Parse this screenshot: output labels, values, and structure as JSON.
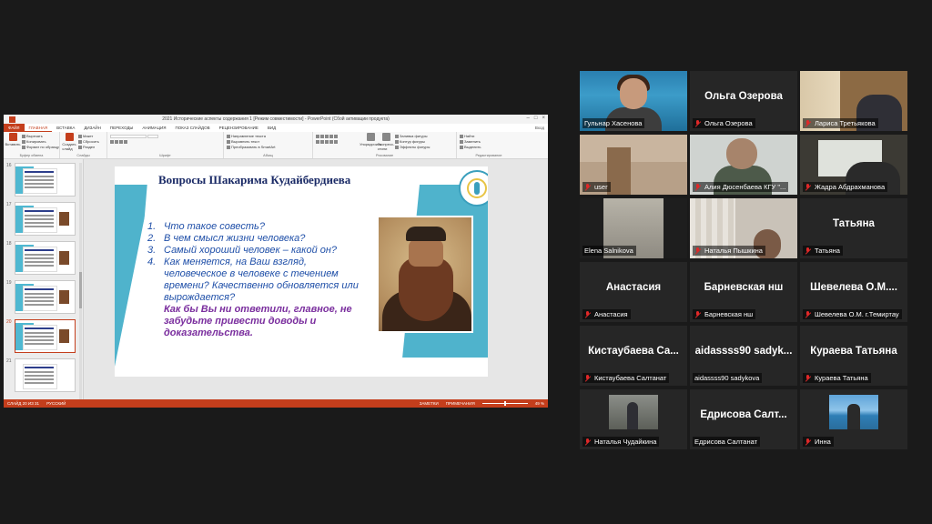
{
  "ppt": {
    "window_title": "2021 Исторические аспекты содержания 1 [Режим совместимости] - PowerPoint (Сбой активации продукта)",
    "signin": "Вход",
    "tabs": [
      "ФАЙЛ",
      "ГЛАВНАЯ",
      "ВСТАВКА",
      "ДИЗАЙН",
      "ПЕРЕХОДЫ",
      "АНИМАЦИЯ",
      "ПОКАЗ СЛАЙДОВ",
      "РЕЦЕНЗИРОВАНИЕ",
      "ВИД"
    ],
    "active_tab_index": 1,
    "ribbon": {
      "clipboard": {
        "paste": "Вставить",
        "cut": "Вырезать",
        "copy": "Копировать",
        "format_painter": "Формат по образцу",
        "group": "Буфер обмена"
      },
      "slides": {
        "new_slide": "Создать слайд",
        "layout": "Макет",
        "reset": "Сбросить",
        "section": "Раздел",
        "group": "Слайды"
      },
      "font": {
        "group": "Шрифт"
      },
      "paragraph": {
        "direction": "Направление текста",
        "align": "Выровнять текст",
        "smartart": "Преобразовать в SmartArt",
        "group": "Абзац"
      },
      "drawing": {
        "arrange": "Упорядочить",
        "styles": "Экспресс-стили",
        "fill": "Заливка фигуры",
        "outline": "Контур фигуры",
        "effects": "Эффекты фигуры",
        "group": "Рисование"
      },
      "editing": {
        "find": "Найти",
        "replace": "Заменить",
        "select": "Выделить",
        "group": "Редактирование"
      }
    },
    "thumbnail_numbers": [
      "16",
      "17",
      "18",
      "19",
      "20",
      "21"
    ],
    "selected_thumbnail": "20",
    "slide": {
      "title": "Вопросы Шакарима Кудайбердиева",
      "questions": [
        {
          "n": "1.",
          "text": "Что такое совесть?"
        },
        {
          "n": "2.",
          "text": "В чем смысл жизни человека?"
        },
        {
          "n": "3.",
          "text": "Самый хороший человек – какой он?"
        },
        {
          "n": "4.",
          "text": "Как меняется, на Ваш взгляд, человеческое в человеке с течением времени? Качественно обновляется или вырождается?"
        }
      ],
      "note": "Как бы Вы ни ответили, главное, не забудьте привести доводы и доказательства."
    },
    "status": {
      "slide_counter": "СЛАЙД 20 ИЗ 31",
      "language": "РУССКИЙ",
      "notes": "ЗАМЕТКИ",
      "comments": "ПРИМЕЧАНИЯ",
      "zoom": "49 %"
    },
    "colors": {
      "accent": "#c43e1c",
      "slide_blue": "#4fb3cc",
      "question_text": "#1f4fa8",
      "note_text": "#7a2e9e"
    }
  },
  "gallery": {
    "tiles": [
      {
        "name": "Гульнар Хасенова",
        "big": "",
        "muted": false,
        "video": "office",
        "active": true
      },
      {
        "name": "Ольга Озерова",
        "big": "Ольга Озерова",
        "muted": true,
        "video": "",
        "active": false
      },
      {
        "name": "Лариса Третьякова",
        "big": "",
        "muted": true,
        "video": "room1",
        "active": false
      },
      {
        "name": "user",
        "big": "",
        "muted": true,
        "video": "room2",
        "active": false
      },
      {
        "name": "Алия Дюсенбаева КГУ \"...",
        "big": "",
        "muted": true,
        "video": "room3",
        "active": false
      },
      {
        "name": "Жадра Абдрахманова",
        "big": "",
        "muted": true,
        "video": "room4",
        "active": false
      },
      {
        "name": "Elena Salnikova",
        "big": "",
        "muted": false,
        "video": "room5",
        "active": false
      },
      {
        "name": "Наталья Пышкина",
        "big": "",
        "muted": true,
        "video": "room6",
        "active": false
      },
      {
        "name": "Татьяна",
        "big": "Татьяна",
        "muted": true,
        "video": "",
        "active": false
      },
      {
        "name": "Анастасия",
        "big": "Анастасия",
        "muted": true,
        "video": "",
        "active": false
      },
      {
        "name": "Барневская нш",
        "big": "Барневская нш",
        "muted": true,
        "video": "",
        "active": false
      },
      {
        "name": "Шевелева О.М. г.Темиртау",
        "big": "Шевелева О.М....",
        "muted": true,
        "video": "",
        "active": false
      },
      {
        "name": "Кистаубаева Салтанат",
        "big": "Кистаубаева Са...",
        "muted": true,
        "video": "",
        "active": false
      },
      {
        "name": "aidassss90 sadykova",
        "big": "aidassss90 sadyk...",
        "muted": false,
        "video": "",
        "active": false
      },
      {
        "name": "Кураева Татьяна",
        "big": "Кураева Татьяна",
        "muted": true,
        "video": "",
        "active": false
      },
      {
        "name": "Наталья Чудайкина",
        "big": "",
        "muted": true,
        "video": "street",
        "active": false
      },
      {
        "name": "Едрисова Салтанат",
        "big": "Едрисова Салт...",
        "muted": false,
        "video": "",
        "active": false
      },
      {
        "name": "Инна",
        "big": "",
        "muted": true,
        "video": "sea",
        "active": false
      }
    ]
  }
}
